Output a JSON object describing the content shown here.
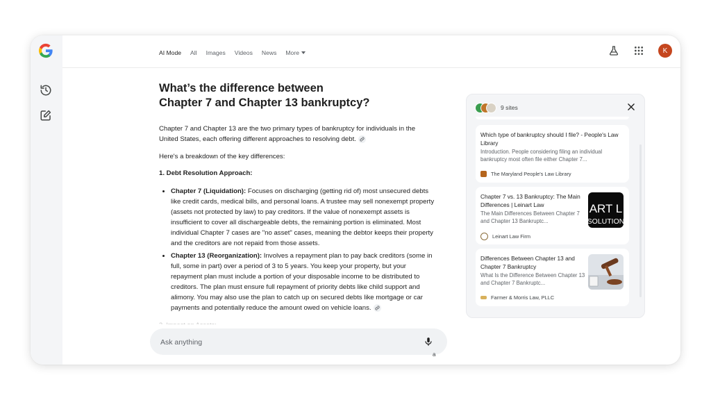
{
  "nav": {
    "tabs": [
      "AI Mode",
      "All",
      "Images",
      "Videos",
      "News"
    ],
    "more_label": "More"
  },
  "user": {
    "avatar_initial": "K",
    "avatar_color": "#c5461e"
  },
  "question": {
    "line1": "What’s the difference between",
    "line2": "Chapter 7 and Chapter 13 bankruptcy?"
  },
  "answer": {
    "intro": "Chapter 7 and Chapter 13 are the two primary types of bankruptcy for individuals in the United States, each offering different approaches to resolving debt.",
    "breakdown": "Here's a breakdown of the key differences:",
    "section1_heading": "1. Debt Resolution Approach:",
    "bullets": [
      {
        "term": "Chapter 7 (Liquidation):",
        "text": " Focuses on discharging (getting rid of) most unsecured debts like credit cards, medical bills, and personal loans. A trustee may sell nonexempt property (assets not protected by law) to pay creditors. If the value of nonexempt assets is insufficient to cover all dischargeable debts, the remaining portion is eliminated. Most individual Chapter 7 cases are \"no asset\" cases, meaning the debtor keeps their property and the creditors are not repaid from those assets."
      },
      {
        "term": "Chapter 13 (Reorganization):",
        "text": " Involves a repayment plan to pay back creditors (some in full, some in part) over a period of 3 to 5 years. You keep your property, but your repayment plan must include a portion of your disposable income to be distributed to creditors. The plan must ensure full repayment of priority debts like child support and alimony. You may also use the plan to catch up on secured debts like mortgage or car payments and potentially reduce the amount owed on vehicle loans."
      }
    ],
    "section2_heading": "2. Impact on Assets:"
  },
  "ask": {
    "placeholder": "Ask anything"
  },
  "tiny_label": "a",
  "sources": {
    "count_label": "9 sites",
    "cards": [
      {
        "title": "Which type of bankruptcy should I file? - People's Law Library",
        "snippet": "Introduction. People considering filing an individual bankruptcy most often file either Chapter 7...",
        "site": "The Maryland People's Law Library",
        "fav_color": "#b5651d"
      },
      {
        "title": "Chapter 7 vs. 13 Bankruptcy: The Main Differences | Leinart Law",
        "snippet": "The Main Differences Between Chapter 7 and Chapter 13 Bankruptc...",
        "site": "Leinart Law Firm",
        "thumb_text_1": "ART L",
        "thumb_text_2": "SOLUTION",
        "fav_color": "#8a6d3b"
      },
      {
        "title": "Differences Between Chapter 13 and Chapter 7 Bankruptcy",
        "snippet": "What Is the Difference Between Chapter 13 and Chapter 7 Bankruptc...",
        "site": "Farmer & Morris Law, PLLC",
        "fav_color": "#d8b15c"
      }
    ]
  },
  "colors": {
    "rail_bg": "#f4f5f7",
    "panel_bg": "#f4f5f7",
    "text": "#1f1f1f",
    "muted": "#5f6368"
  }
}
